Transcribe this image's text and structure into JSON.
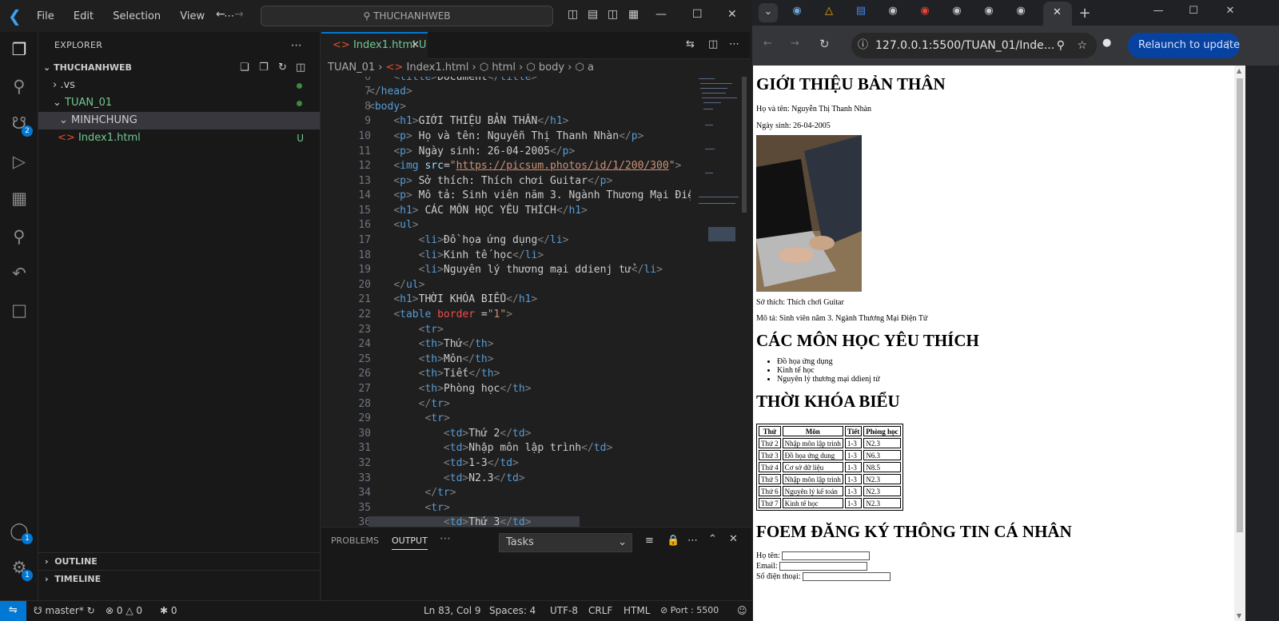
{
  "vscode": {
    "menu": [
      "File",
      "Edit",
      "Selection",
      "View",
      "⋯"
    ],
    "search_text": "THUCHANHWEB",
    "activity_badges": {
      "source_control": "2",
      "accounts": "1",
      "manage": "1"
    },
    "explorer": {
      "title": "EXPLORER",
      "root": "THUCHANHWEB",
      "items": [
        {
          "label": ".vs",
          "marker": "dot"
        },
        {
          "label": "TUAN_01",
          "marker": "dot"
        },
        {
          "label": "MINHCHUNG",
          "marker": ""
        },
        {
          "label": "Index1.html",
          "marker": "U"
        }
      ],
      "outline": "OUTLINE",
      "timeline": "TIMELINE"
    },
    "tab": {
      "label": "Index1.html",
      "status": "U"
    },
    "breadcrumb": [
      "TUAN_01",
      "Index1.html",
      "html",
      "body",
      "a"
    ],
    "line_numbers": [
      "6",
      "7",
      "8",
      "9",
      "10",
      "11",
      "12",
      "13",
      "14",
      "15",
      "16",
      "17",
      "18",
      "19",
      "20",
      "21",
      "22",
      "23",
      "24",
      "25",
      "26",
      "27",
      "28",
      "29",
      "30",
      "31",
      "32",
      "33",
      "34",
      "35",
      "36"
    ],
    "panel": {
      "tabs": [
        "PROBLEMS",
        "OUTPUT",
        "⋯"
      ],
      "select": "Tasks"
    },
    "status": {
      "branch": "master*",
      "errors": "0",
      "warnings": "0",
      "ports": "0",
      "position": "Ln 83, Col 9",
      "spaces": "Spaces: 4",
      "encoding": "UTF-8",
      "eol": "CRLF",
      "language": "HTML",
      "port": "Port : 5500"
    }
  },
  "chrome": {
    "url": "127.0.0.1:5500/TUAN_01/Inde...",
    "relaunch": "Relaunch to update",
    "colors": {
      "accent": "#0842a0",
      "tab_bg": "#35363a"
    }
  },
  "page": {
    "h1_intro": "GIỚI THIỆU BẢN THÂN",
    "name": "Họ và tên: Nguyễn Thị Thanh Nhàn",
    "dob": "Ngày sinh: 26-04-2005",
    "hobby": "Sở thích: Thích chơi Guitar",
    "desc": "Mô tả: Sinh viên năm 3. Ngành Thương Mại Điện Tử",
    "h1_subjects": "CÁC MÔN HỌC YÊU THÍCH",
    "subjects": [
      "Đồ họa ứng dụng",
      "Kinh tế học",
      "Nguyên lý thương mại ddienj tử"
    ],
    "h1_schedule": "THỜI KHÓA BIỂU",
    "table": {
      "headers": [
        "Thứ",
        "Môn",
        "Tiết",
        "Phòng học"
      ],
      "rows": [
        [
          "Thứ 2",
          "Nhập môn lập trình",
          "1-3",
          "N2.3"
        ],
        [
          "Thứ 3",
          "Đồ họa ứng dung",
          "1-3",
          "N6.3"
        ],
        [
          "Thứ 4",
          "Cơ sở dữ liệu",
          "1-3",
          "N8.5"
        ],
        [
          "Thứ 5",
          "Nhập môn lập trình",
          "1-3",
          "N2.3"
        ],
        [
          "Thứ 6",
          "Nguyên lý kế toán",
          "1-3",
          "N2.3"
        ],
        [
          "Thứ 7",
          "Kinh tế học",
          "1-3",
          "N2.3"
        ]
      ]
    },
    "h1_form": "FOEM ĐĂNG KÝ THÔNG TIN CÁ NHÂN",
    "form": [
      "Họ tên:",
      "Email:",
      "Số điện thoại:"
    ]
  }
}
